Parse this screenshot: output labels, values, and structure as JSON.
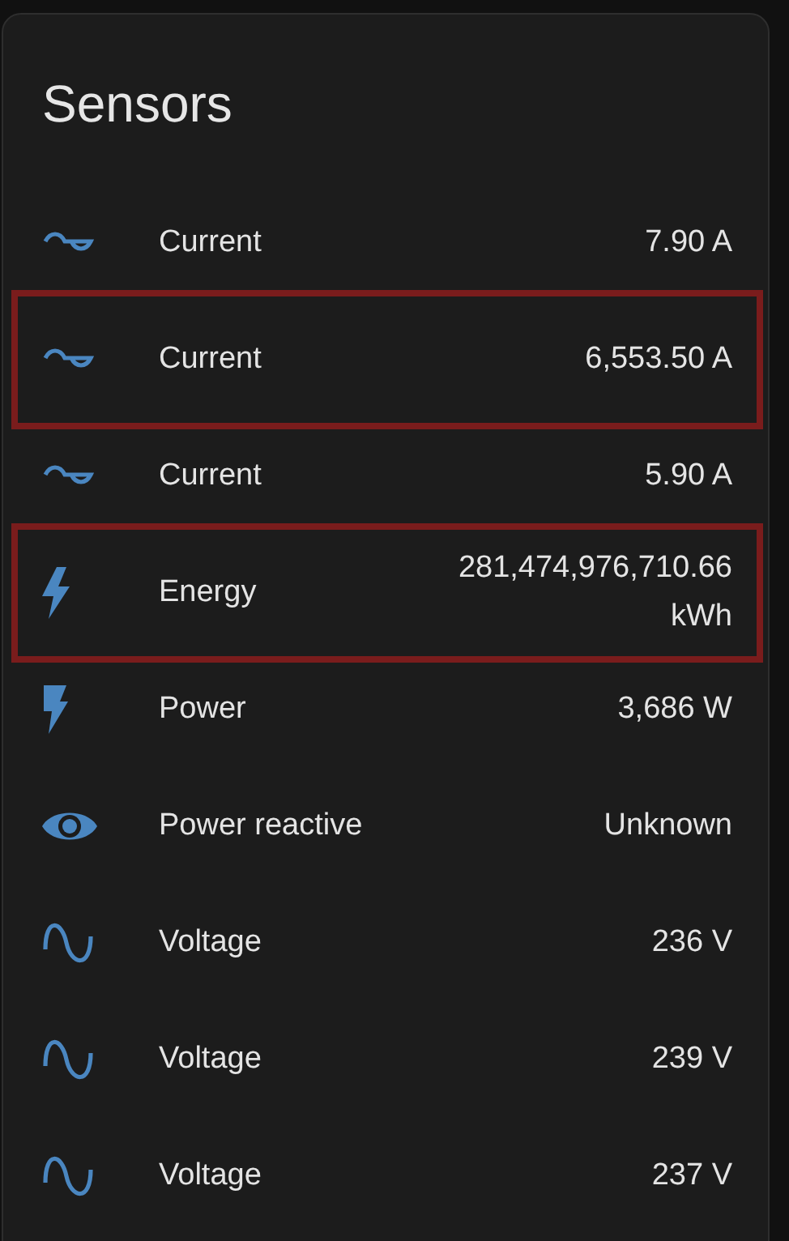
{
  "card": {
    "title": "Sensors"
  },
  "rows": [
    {
      "kind": "current",
      "name": "Current",
      "value": "7.90 A",
      "highlighted": false
    },
    {
      "kind": "current",
      "name": "Current",
      "value": "6,553.50 A",
      "highlighted": true
    },
    {
      "kind": "current",
      "name": "Current",
      "value": "5.90 A",
      "highlighted": false
    },
    {
      "kind": "energy",
      "name": "Energy",
      "value": "281,474,976,710.66 kWh",
      "highlighted": true
    },
    {
      "kind": "power",
      "name": "Power",
      "value": "3,686 W",
      "highlighted": false
    },
    {
      "kind": "reactive",
      "name": "Power reactive",
      "value": "Unknown",
      "highlighted": false
    },
    {
      "kind": "voltage",
      "name": "Voltage",
      "value": "236 V",
      "highlighted": false
    },
    {
      "kind": "voltage",
      "name": "Voltage",
      "value": "239 V",
      "highlighted": false
    },
    {
      "kind": "voltage",
      "name": "Voltage",
      "value": "237 V",
      "highlighted": false
    }
  ]
}
